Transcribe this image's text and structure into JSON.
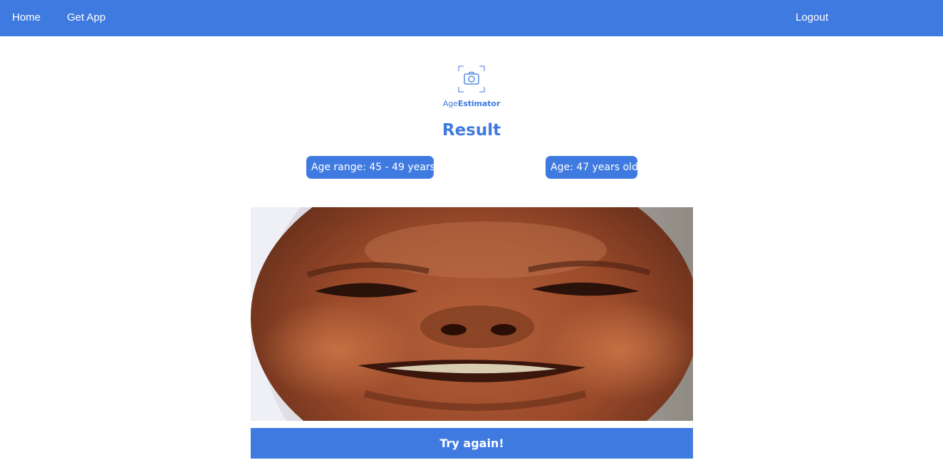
{
  "nav": {
    "home_label": "Home",
    "get_app_label": "Get App",
    "logout_label": "Logout"
  },
  "logo": {
    "text_light": "Age",
    "text_bold": "Estimator",
    "icon": "camera-icon"
  },
  "result": {
    "title": "Result",
    "age_range_text": "Age range: 45 - 49 years",
    "age_text": "Age: 47 years old"
  },
  "photo": {
    "subject": "face-photo"
  },
  "actions": {
    "try_again_label": "Try again!"
  },
  "colors": {
    "accent": "#3f7ae0",
    "background": "#ffffff",
    "text_on_accent": "#ffffff"
  }
}
